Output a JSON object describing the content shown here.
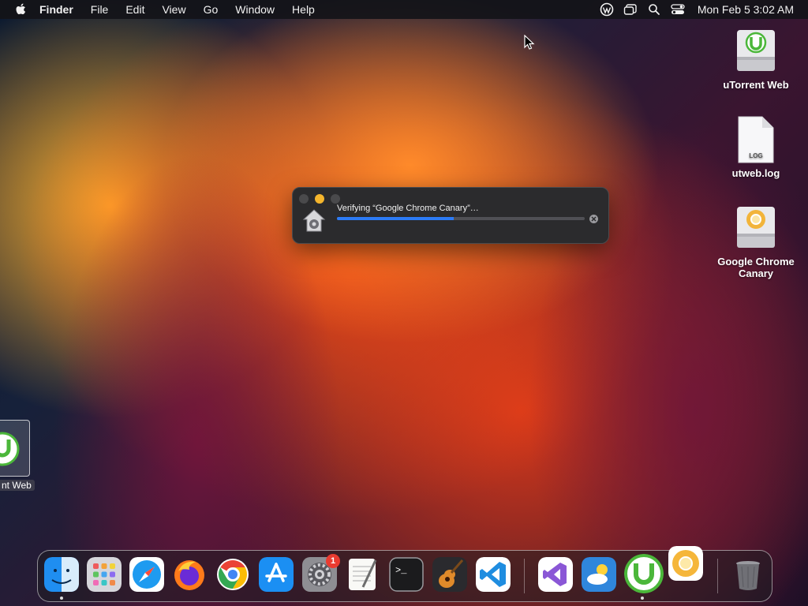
{
  "menubar": {
    "app_name": "Finder",
    "menus": [
      "File",
      "Edit",
      "View",
      "Go",
      "Window",
      "Help"
    ],
    "clock": "Mon Feb 5  3:02 AM"
  },
  "desktop": {
    "icons": [
      {
        "label": "uTorrent Web"
      },
      {
        "label": "utweb.log",
        "file_tag": "LOG"
      },
      {
        "label": "Google Chrome Canary"
      }
    ],
    "drag_icon_label": "nt Web"
  },
  "progress": {
    "message": "Verifying “Google Chrome Canary”…",
    "percent": 47
  },
  "dock": {
    "apps": [
      "Finder",
      "Launchpad",
      "Safari",
      "Firefox",
      "Google Chrome",
      "App Store",
      "System Settings",
      "TextEdit",
      "Terminal",
      "GarageBand",
      "Visual Studio Code",
      "Visual Studio",
      "Weather",
      "uTorrent Web",
      "Google Chrome Canary",
      "Trash"
    ],
    "badge_count": "1",
    "terminal_glyph": ">_"
  },
  "colors": {
    "accent": "#2c7bf6",
    "traffic_yellow": "#f4b52d",
    "badge_red": "#ea3b30"
  }
}
